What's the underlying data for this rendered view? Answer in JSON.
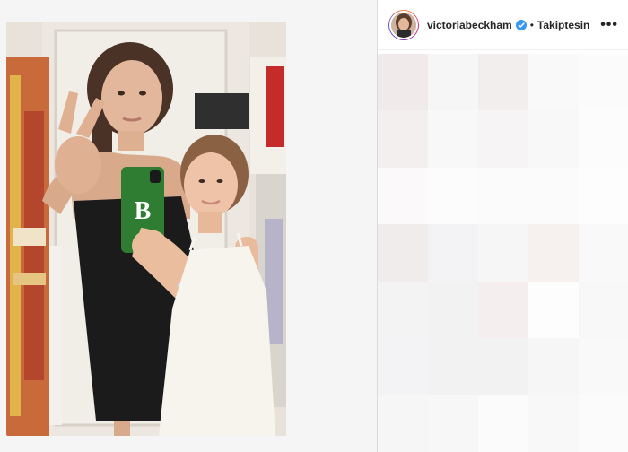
{
  "post": {
    "username": "victoriabeckham",
    "separator": "•",
    "follow_status": "Takiptesin",
    "more_label": "•••",
    "phone_case_text": "B"
  },
  "icons": {
    "verified": "verified-badge-icon",
    "more": "more-options-icon"
  },
  "colors": {
    "verified_blue": "#3897f0",
    "sidebar_bg": "#ffffff",
    "page_bg": "#fafafa"
  },
  "blur_grid": [
    "#f1eaea",
    "#f6f6f6",
    "#f2eeee",
    "#f9f9f9",
    "#fbfbfb",
    "#f3efee",
    "#f8f8f8",
    "#f6f4f4",
    "#f8f8f8",
    "#fcfcfc",
    "#fbf9f9",
    "#fcfcfc",
    "#fbfbfb",
    "#fbfbfb",
    "#fdfdfd",
    "#f0eceb",
    "#f3f3f5",
    "#f6f6f6",
    "#f6f0ef",
    "#f9f9f9",
    "#f3f3f3",
    "#f2f2f2",
    "#f4eeee",
    "#fdfdfd",
    "#f8f8f8",
    "#f3f3f5",
    "#f2f2f2",
    "#f2f2f2",
    "#f6f6f6",
    "#f9f9f9",
    "#f6f6f6",
    "#f7f7f7",
    "#fbfbfb",
    "#f8f8f8",
    "#fbfbfb"
  ]
}
